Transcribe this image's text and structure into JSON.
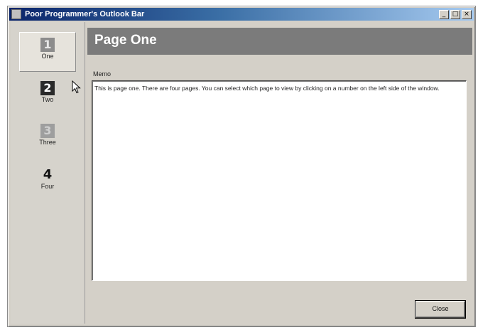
{
  "window": {
    "title": "Poor Programmer's Outlook Bar",
    "controls": {
      "minimize": "_",
      "maximize": "□",
      "close": "×"
    }
  },
  "sidebar": {
    "items": [
      {
        "number": "1",
        "label": "One",
        "state": "selected"
      },
      {
        "number": "2",
        "label": "Two",
        "state": "normal"
      },
      {
        "number": "3",
        "label": "Three",
        "state": "disabled"
      },
      {
        "number": "4",
        "label": "Four",
        "state": "normal"
      }
    ]
  },
  "main": {
    "header_title": "Page One",
    "memo_label": "Memo",
    "memo_text": "This is page one. There are four pages. You can select which page to view by clicking on a number on the left side of the window.",
    "close_label": "Close"
  },
  "colors": {
    "titlebar_start": "#0a246a",
    "titlebar_end": "#a6caf0",
    "header_bg": "#7b7b7b",
    "window_bg": "#d4d0c8"
  }
}
